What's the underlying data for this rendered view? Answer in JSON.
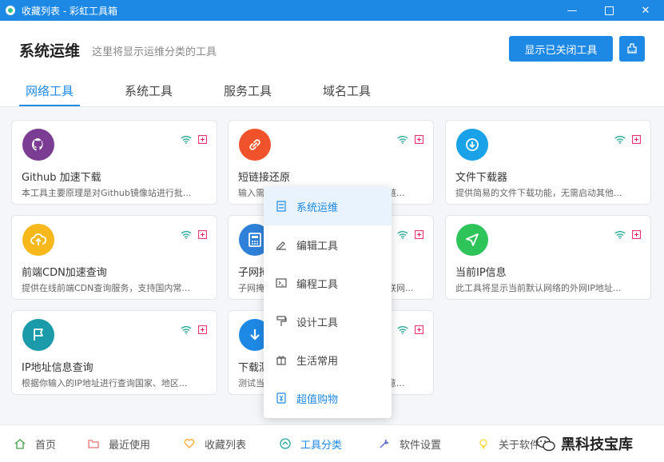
{
  "window": {
    "title": "收藏列表 - 彩虹工具箱",
    "icon": "app-logo-icon",
    "controls": [
      "minimize-icon",
      "maximize-icon",
      "close-icon"
    ]
  },
  "header": {
    "title": "系统运维",
    "subtitle": "这里将显示运维分类的工具",
    "show_closed_button": "显示已关闭工具",
    "clean_button_icon": "broom-icon"
  },
  "tabs": [
    "网络工具",
    "系统工具",
    "服务工具",
    "域名工具"
  ],
  "active_tab": 0,
  "colors": {
    "accent": "#1e88e5",
    "wifi": "#26a69a",
    "plus": "#e91e63"
  },
  "cards": [
    {
      "name": "Github 加速下载",
      "desc": "本工具主要原理是对Github镜像站进行批...",
      "icon": "github-icon",
      "color": "#7b3d93"
    },
    {
      "name": "短链接还原",
      "desc": "输入需要还原的短链接，即可还原后的链...",
      "icon": "link-icon",
      "color": "#f0532b"
    },
    {
      "name": "文件下载器",
      "desc": "提供简易的文件下载功能，无需启动其他...",
      "icon": "download-circle-icon",
      "color": "#1aa2e8"
    },
    {
      "name": "前端CDN加速查询",
      "desc": "提供在线前端CDN查询服务，支持国内常...",
      "icon": "cloud-upload-icon",
      "color": "#f6b81a"
    },
    {
      "name": "子网掩码计算",
      "desc": "子网掩码计算器可以帮助您计算局域网联网...",
      "icon": "calculator-icon",
      "color": "#2f80d8"
    },
    {
      "name": "当前IP信息",
      "desc": "此工具将显示当前默认网络的外网IP地址...",
      "icon": "send-icon",
      "color": "#2fc45a"
    },
    {
      "name": "IP地址信息查询",
      "desc": "根据你输入的IP地址进行查询国家、地区...",
      "icon": "flag-icon",
      "color": "#1b9aaa"
    },
    {
      "name": "下载测速",
      "desc": "测试当前网络的下载速度，测试时请注意...",
      "icon": "arrow-down-icon",
      "color": "#1e88e5"
    }
  ],
  "menu": [
    {
      "label": "系统运维",
      "icon": "server-icon"
    },
    {
      "label": "编辑工具",
      "icon": "pen-icon"
    },
    {
      "label": "编程工具",
      "icon": "terminal-icon"
    },
    {
      "label": "设计工具",
      "icon": "paint-roller-icon"
    },
    {
      "label": "生活常用",
      "icon": "gift-icon"
    },
    {
      "label": "超值购物",
      "icon": "shopping-icon"
    }
  ],
  "bottom_nav": [
    {
      "label": "首页",
      "icon": "home-icon",
      "color": "#43a047"
    },
    {
      "label": "最近使用",
      "icon": "folder-icon",
      "color": "#e57373"
    },
    {
      "label": "收藏列表",
      "icon": "heart-icon",
      "color": "#ffa726"
    },
    {
      "label": "工具分类",
      "icon": "category-icon",
      "color": "#26a69a"
    },
    {
      "label": "软件设置",
      "icon": "wrench-icon",
      "color": "#5c6bc0"
    },
    {
      "label": "关于软件",
      "icon": "bulb-icon",
      "color": "#fdd835"
    }
  ],
  "watermark": "黑科技宝库"
}
